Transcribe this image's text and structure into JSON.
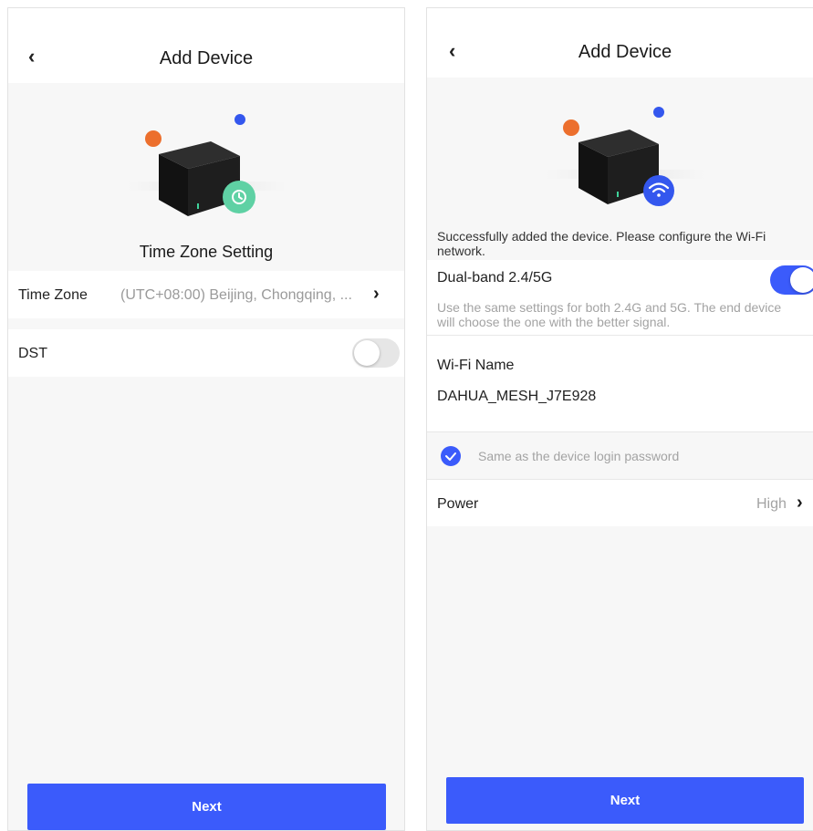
{
  "left": {
    "header": {
      "title": "Add Device",
      "back_glyph": "‹"
    },
    "subtitle": "Time Zone Setting",
    "time_zone": {
      "label": "Time Zone",
      "value": "(UTC+08:00) Beijing, Chongqing, ...",
      "chevron": "›"
    },
    "dst": {
      "label": "DST",
      "enabled": false
    },
    "next_label": "Next",
    "icons": {
      "hero_badge": "clock-icon"
    }
  },
  "right": {
    "header": {
      "title": "Add Device",
      "back_glyph": "‹"
    },
    "success_line1": "Successfully added the device. Please configure the Wi-Fi",
    "success_line2": "network.",
    "dual_band": {
      "label": "Dual-band 2.4/5G",
      "enabled": true,
      "hint_line1": "Use the same settings for both 2.4G and 5G. The end device",
      "hint_line2": "will choose the one with the better signal."
    },
    "wifi_name": {
      "label": "Wi-Fi Name",
      "value": "DAHUA_MESH_J7E928"
    },
    "same_password": {
      "label": "Same as the device login password",
      "checked": true
    },
    "power": {
      "label": "Power",
      "value": "High",
      "chevron": "›"
    },
    "next_label": "Next",
    "icons": {
      "hero_badge": "wifi-icon"
    }
  },
  "colors": {
    "accent": "#3b5bfb",
    "orange_dot": "#ec6f2d",
    "blue_dot": "#3457ee",
    "clock_badge": "#5fd1a4",
    "background": "#f7f7f7"
  }
}
